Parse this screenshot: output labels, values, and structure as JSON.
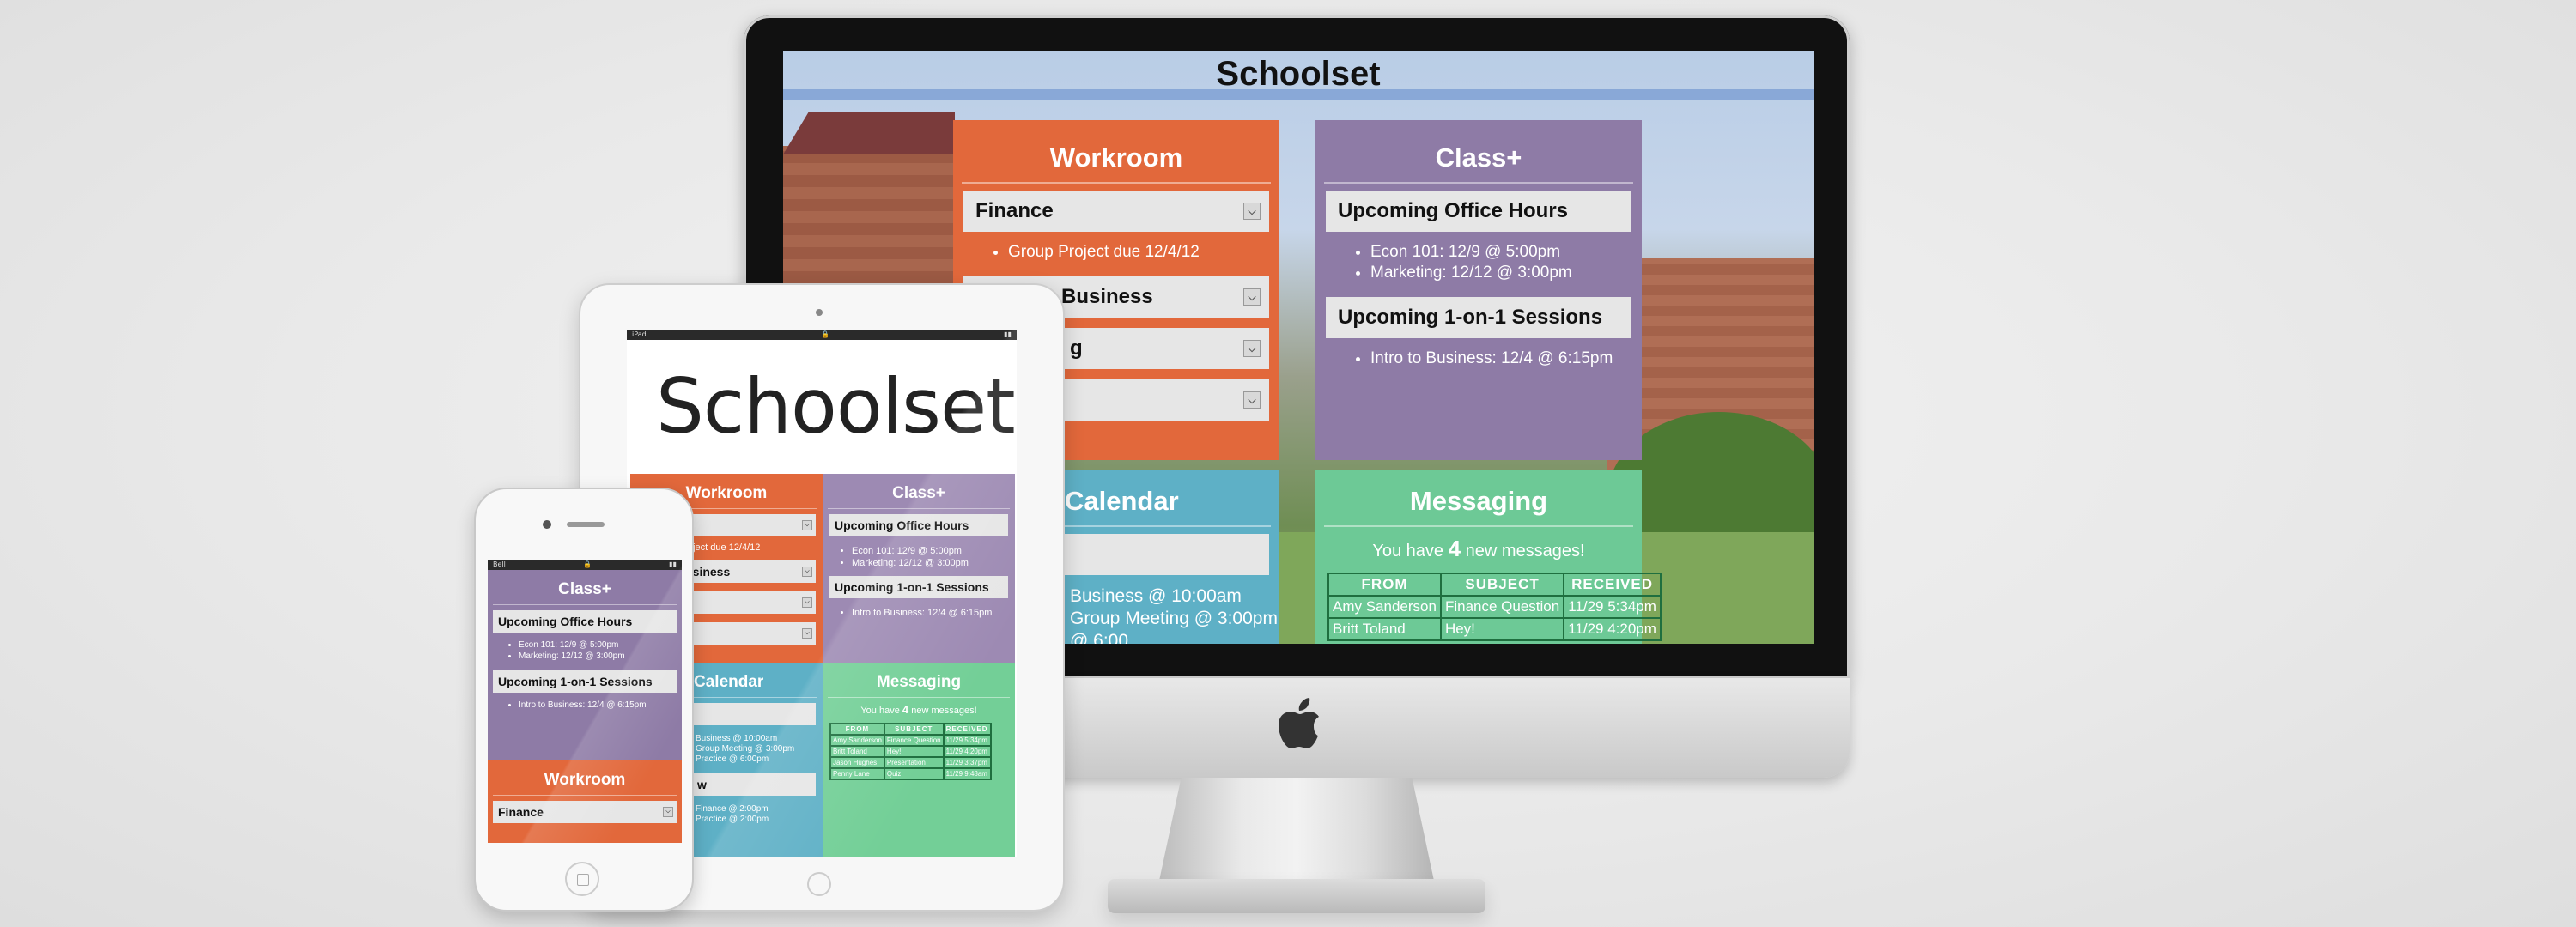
{
  "brand": "Schoolset",
  "colors": {
    "workroom": "#e2683b",
    "classplus": "#8e7ba6",
    "calendar": "#5eb0c6",
    "messaging": "#6dc996",
    "dropdown": "#e6e6e6"
  },
  "icons": {
    "dropdown": "chevron-down-icon",
    "apple": "apple-logo-icon",
    "lock": "lock-icon",
    "signal": "signal-icon",
    "wifi": "wifi-icon",
    "battery": "battery-icon"
  },
  "desktop": {
    "workroom": {
      "title": "Workroom",
      "dd1": "Finance",
      "dd1_item": "Group Project due 12/4/12",
      "dd2": "Business",
      "dd3": "g",
      "dd4": ""
    },
    "classplus": {
      "title": "Class+",
      "office_hours": "Upcoming Office Hours",
      "oh1": "Econ 101: 12/9 @ 5:00pm",
      "oh2": "Marketing: 12/12 @ 3:00pm",
      "sessions": "Upcoming 1-on-1 Sessions",
      "s1": "Intro to Business: 12/4 @ 6:15pm"
    },
    "calendar": {
      "title": "Calendar",
      "e1": "Business @ 10:00am",
      "e2": "Group Meeting @ 3:00pm",
      "e3": "@ 6:00"
    },
    "messaging": {
      "title": "Messaging",
      "notice_pre": "You have",
      "count": "4",
      "notice_post": "new messages!",
      "headers": [
        "FROM",
        "SUBJECT",
        "RECEIVED"
      ],
      "rows": [
        [
          "Amy Sanderson",
          "Finance Question",
          "11/29 5:34pm"
        ],
        [
          "Britt Toland",
          "Hey!",
          "11/29 4:20pm"
        ]
      ]
    }
  },
  "tablet": {
    "status_left": "iPad",
    "workroom": {
      "title": "Workroom",
      "dd1": "",
      "dd1_item": "Project due 12/4/12",
      "dd2": "Business",
      "dd3": "g",
      "dd4": ""
    },
    "classplus": {
      "title": "Class+",
      "office_hours": "Upcoming Office Hours",
      "oh1": "Econ 101: 12/9 @ 5:00pm",
      "oh2": "Marketing: 12/12 @ 3:00pm",
      "sessions": "Upcoming 1-on-1 Sessions",
      "s1": "Intro to Business: 12/4 @ 6:15pm"
    },
    "calendar": {
      "title": "Calendar",
      "dd1": "",
      "e1": "Business @ 10:00am",
      "e2": "Group Meeting @ 3:00pm",
      "e3": "Practice @ 6:00pm",
      "dd2": "w",
      "e4": "Finance @ 2:00pm",
      "e5": "Practice @ 2:00pm"
    },
    "messaging": {
      "title": "Messaging",
      "notice_pre": "You have",
      "count": "4",
      "notice_post": "new messages!",
      "headers": [
        "FROM",
        "SUBJECT",
        "RECEIVED"
      ],
      "rows": [
        [
          "Amy Sanderson",
          "Finance Question",
          "11/29 5:34pm"
        ],
        [
          "Britt Toland",
          "Hey!",
          "11/29 4:20pm"
        ],
        [
          "Jason Hughes",
          "Presentation",
          "11/29 3:37pm"
        ],
        [
          "Penny Lane",
          "Quiz!",
          "11/29 9:48am"
        ]
      ]
    }
  },
  "phone": {
    "status_left": "Bell",
    "classplus": {
      "title": "Class+",
      "office_hours": "Upcoming Office Hours",
      "oh1": "Econ 101: 12/9 @ 5:00pm",
      "oh2": "Marketing: 12/12 @ 3:00pm",
      "sessions": "Upcoming 1-on-1 Sessions",
      "s1": "Intro to Business: 12/4 @ 6:15pm"
    },
    "workroom": {
      "title": "Workroom",
      "dd1": "Finance"
    }
  }
}
